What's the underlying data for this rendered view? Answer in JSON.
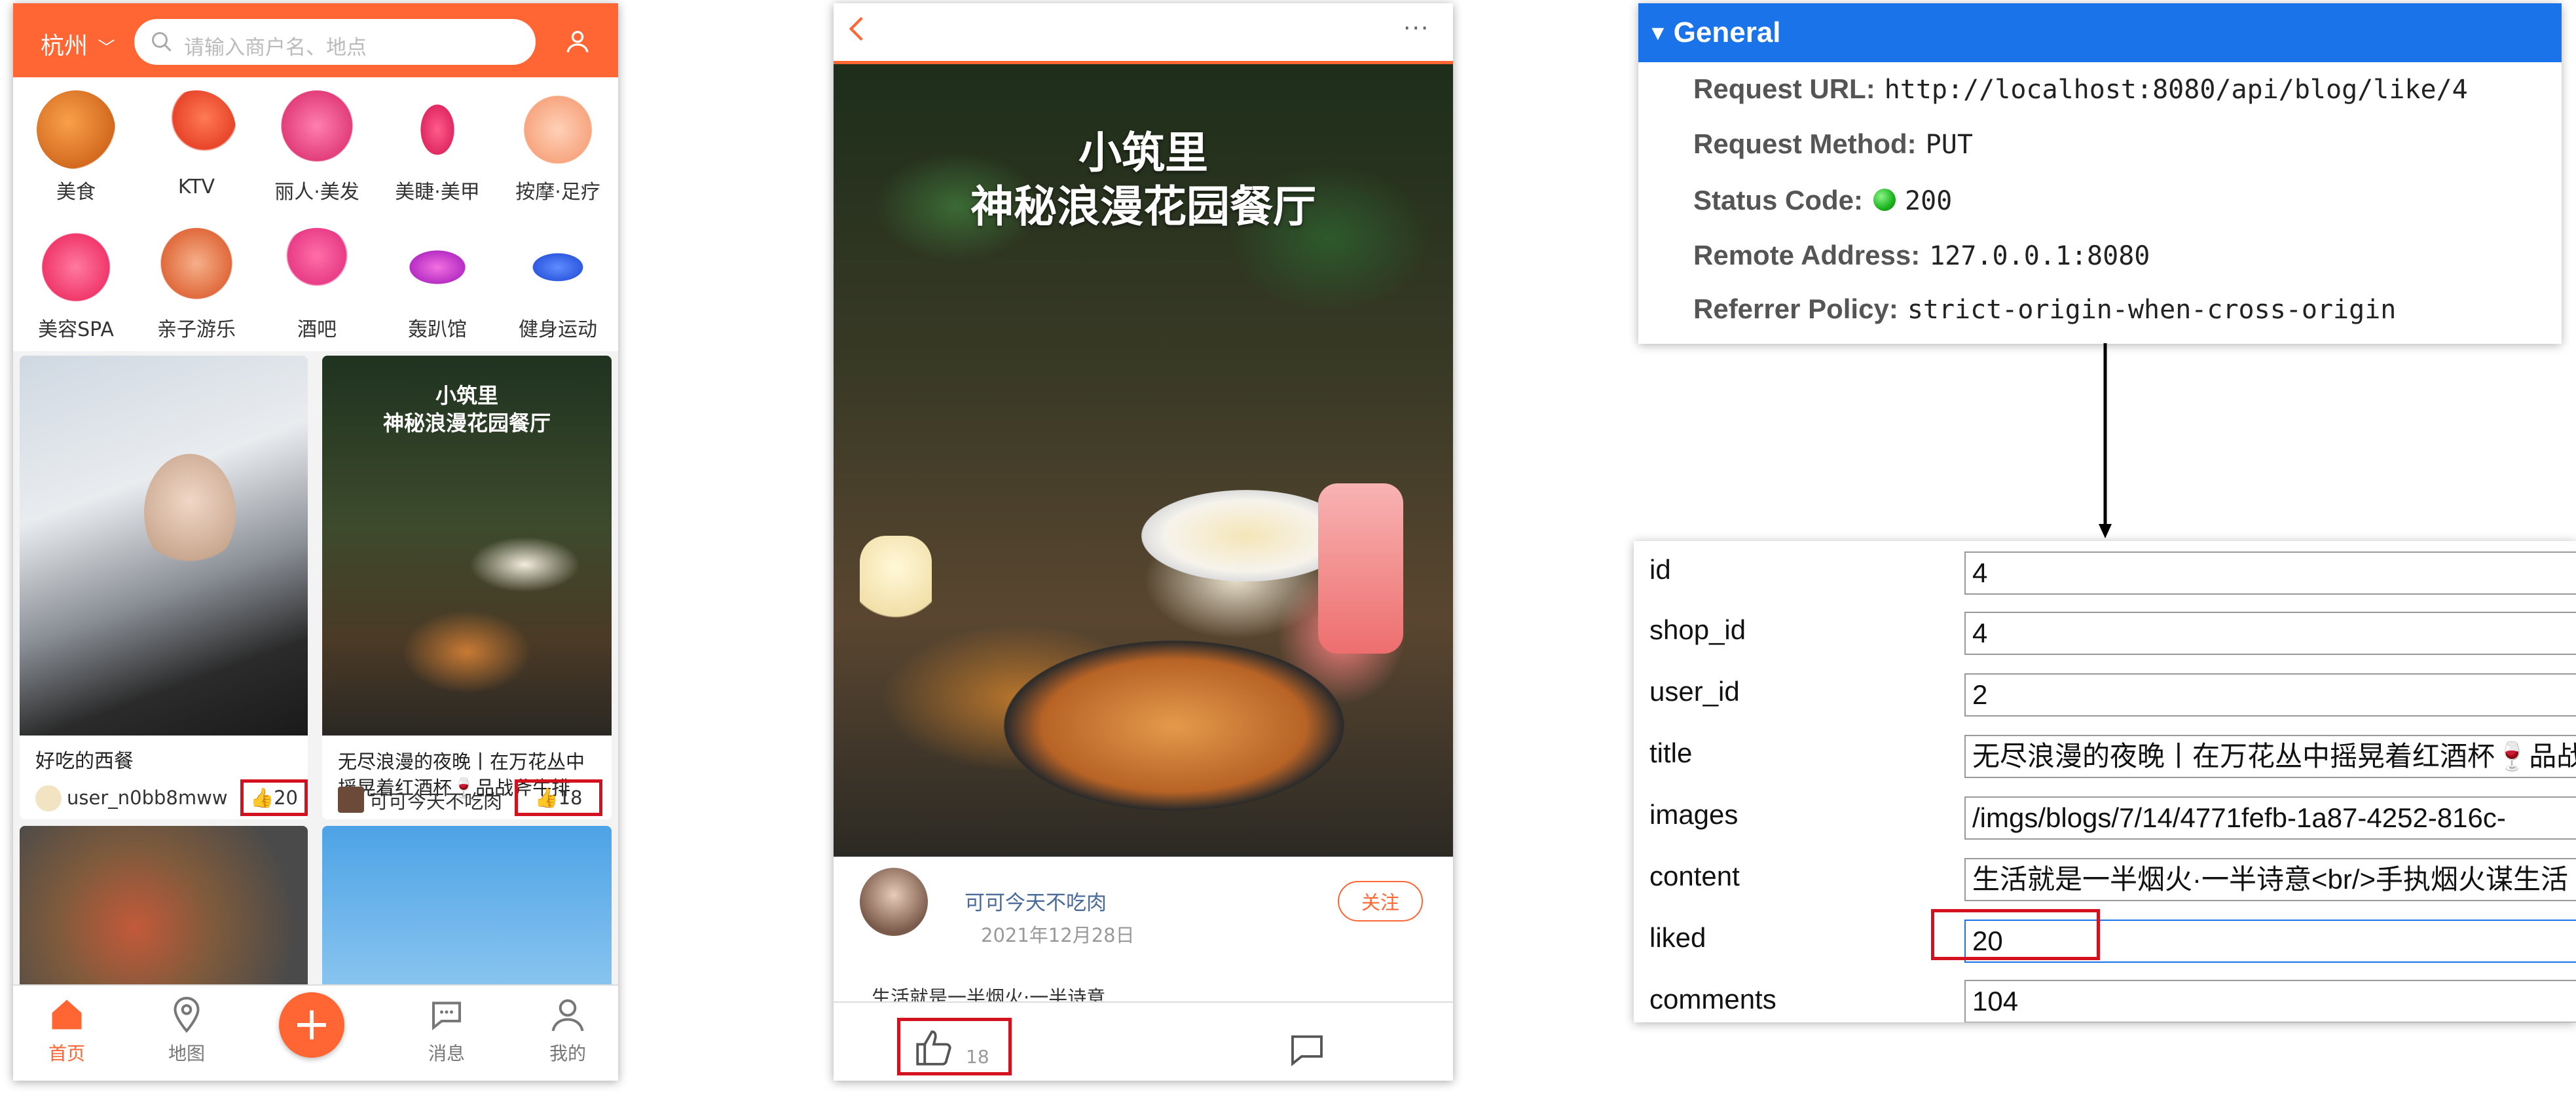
{
  "home": {
    "city": "杭州",
    "search_placeholder": "请输入商户名、地点",
    "categories": [
      "美食",
      "KTV",
      "丽人·美发",
      "美睫·美甲",
      "按摩·足疗",
      "美容SPA",
      "亲子游乐",
      "酒吧",
      "轰趴馆",
      "健身运动"
    ],
    "cards": [
      {
        "title": "好吃的西餐",
        "author": "user_n0bb8mww",
        "likes": "20"
      },
      {
        "title_line1": "无尽浪漫的夜晚丨在万花丛中",
        "title_line2": "摇晃着红酒杯🍷品战斧牛排",
        "author": "可可今天不吃肉",
        "likes": "18",
        "image_title_1": "小筑里",
        "image_title_2": "神秘浪漫花园餐厅"
      }
    ],
    "tabs": [
      "首页",
      "地图",
      "消息",
      "我的"
    ]
  },
  "detail": {
    "photo_title_1": "小筑里",
    "photo_title_2": "神秘浪漫花园餐厅",
    "author": "可可今天不吃肉",
    "date": "2021年12月28日",
    "follow": "关注",
    "content_peek": "生活就是一半烟火·一半诗意",
    "like_count": "18"
  },
  "devtools": {
    "section": "General",
    "rows": [
      {
        "key": "Request URL:",
        "value": "http://localhost:8080/api/blog/like/4"
      },
      {
        "key": "Request Method:",
        "value": "PUT"
      },
      {
        "key": "Status Code:",
        "value": "200"
      },
      {
        "key": "Remote Address:",
        "value": "127.0.0.1:8080"
      },
      {
        "key": "Referrer Policy:",
        "value": "strict-origin-when-cross-origin"
      }
    ],
    "status_color": "#1db31d"
  },
  "record": {
    "fields": [
      {
        "label": "id",
        "value": "4"
      },
      {
        "label": "shop_id",
        "value": "4"
      },
      {
        "label": "user_id",
        "value": "2"
      },
      {
        "label": "title",
        "value": "无尽浪漫的夜晚丨在万花丛中摇晃着红酒杯🍷品战"
      },
      {
        "label": "images",
        "value": "/imgs/blogs/7/14/4771fefb-1a87-4252-816c-"
      },
      {
        "label": "content",
        "value": "生活就是一半烟火·一半诗意<br/>手执烟火谋生活"
      },
      {
        "label": "liked",
        "value": "20"
      },
      {
        "label": "comments",
        "value": "104"
      }
    ]
  },
  "colors": {
    "accent": "#ff6633",
    "highlight": "#d4111f",
    "devtools_blue": "#1a73e8"
  }
}
